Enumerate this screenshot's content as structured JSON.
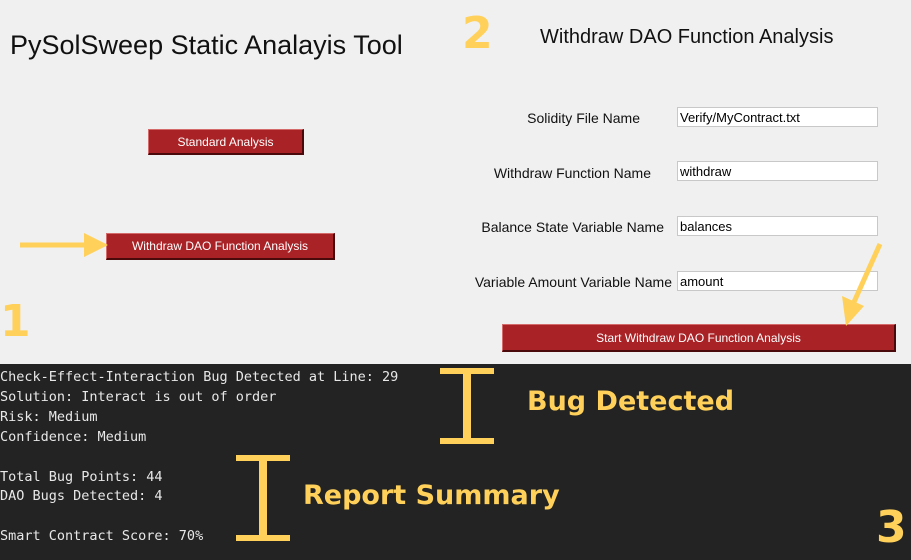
{
  "app": {
    "title": "PySolSweep Static Analayis Tool"
  },
  "left_panel": {
    "standard_button": "Standard Analysis",
    "withdraw_button": "Withdraw DAO Function Analysis"
  },
  "right_panel": {
    "title": "Withdraw DAO Function Analysis",
    "fields": [
      {
        "label": "Solidity File Name",
        "value": "Verify/MyContract.txt"
      },
      {
        "label": "Withdraw Function Name",
        "value": "withdraw"
      },
      {
        "label": "Balance State Variable Name",
        "value": "balances"
      },
      {
        "label": "Variable Amount Variable Name",
        "value": "amount"
      }
    ],
    "start_button": "Start Withdraw DAO Function Analysis"
  },
  "console": {
    "lines": [
      "Check-Effect-Interaction Bug Detected at Line: 29",
      "Solution: Interact is out of order",
      "Risk: Medium",
      "Confidence: Medium",
      "Total Bug Points: 44",
      "DAO Bugs Detected: 4",
      "Smart Contract Score: 70%"
    ]
  },
  "annotations": {
    "step1": "1",
    "step2": "2",
    "step3": "3",
    "bug_detected": "Bug Detected",
    "report_summary": "Report Summary",
    "color": "#ffd15a"
  }
}
